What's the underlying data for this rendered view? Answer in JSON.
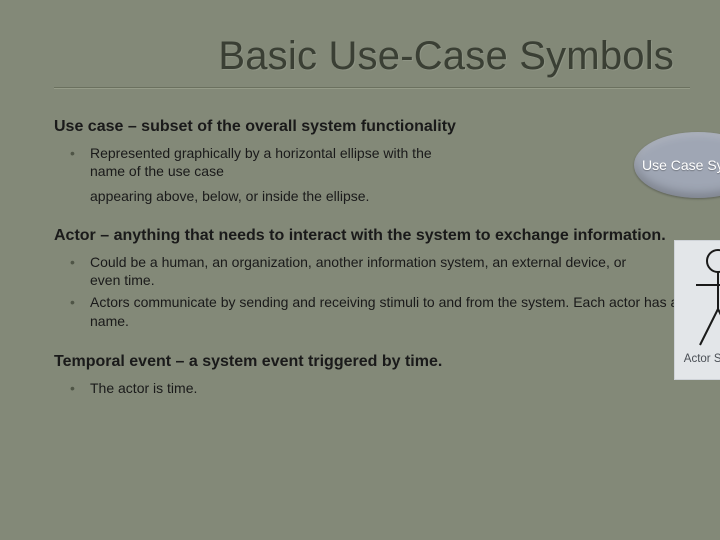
{
  "title": "Basic Use-Case Symbols",
  "sections": {
    "use_case": {
      "heading": "Use case – subset of the overall system functionality",
      "bullets": [
        "Represented graphically by a horizontal ellipse with the name of the use case"
      ],
      "after_note": "appearing above, below, or inside the ellipse."
    },
    "actor": {
      "heading": "Actor – anything that needs to interact with the system to exchange information.",
      "bullets": [
        "Could be a human, an organization, another information system, an external device,  or even time.",
        "Actors communicate by sending and receiving stimuli to and from the system. Each actor has a name."
      ]
    },
    "temporal": {
      "heading": "Temporal event – a system event triggered by time.",
      "bullets": [
        "The actor is time."
      ]
    }
  },
  "figures": {
    "usecase_label": "Use Case Symbol",
    "actor_label": "Actor Symbol"
  }
}
